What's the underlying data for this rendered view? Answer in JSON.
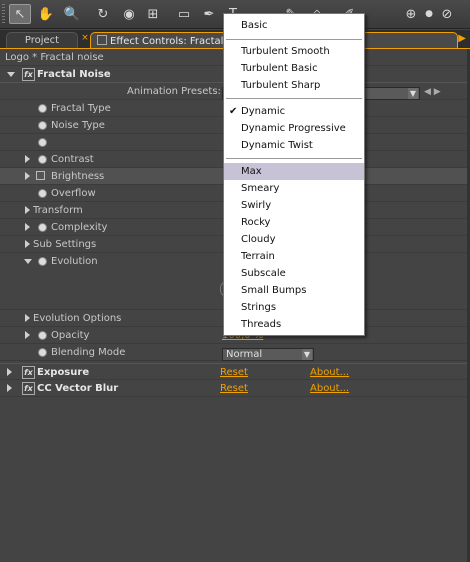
{
  "toolbar": {
    "tools": [
      {
        "name": "selection-tool-icon",
        "glyph": "↖",
        "active": true
      },
      {
        "name": "hand-tool-icon",
        "glyph": "✋"
      },
      {
        "name": "zoom-tool-icon",
        "glyph": "🔍"
      },
      {
        "name": "rotate-tool-icon",
        "glyph": "↻"
      },
      {
        "name": "orbit-camera-icon",
        "glyph": "◉"
      },
      {
        "name": "pan-behind-icon",
        "glyph": "⊞"
      },
      {
        "name": "rectangle-tool-icon",
        "glyph": "▭"
      },
      {
        "name": "pen-tool-icon",
        "glyph": "✒"
      },
      {
        "name": "type-tool-icon",
        "glyph": "T"
      },
      {
        "name": "brush-tool-icon",
        "glyph": "✎"
      },
      {
        "name": "eraser-tool-icon",
        "glyph": "◇"
      },
      {
        "name": "puppet-tool-icon",
        "glyph": "✐"
      },
      {
        "name": "axis-local-icon",
        "glyph": "⊕"
      },
      {
        "name": "axis-world-icon",
        "glyph": "●"
      },
      {
        "name": "axis-view-icon",
        "glyph": "⊘"
      }
    ]
  },
  "tabs": {
    "project": "Project",
    "effect_controls": "Effect Controls: Fractal"
  },
  "panel": {
    "layer_path": "Logo * Fractal noise",
    "fractal_noise": {
      "name": "Fractal Noise",
      "animation_presets_label": "Animation Presets:",
      "properties": {
        "fractal_type": "Fractal Type",
        "noise_type": "Noise Type",
        "invert": "",
        "contrast": "Contrast",
        "brightness": "Brightness",
        "overflow": "Overflow",
        "transform": "Transform",
        "complexity": "Complexity",
        "sub_settings": "Sub Settings",
        "evolution": "Evolution",
        "evolution_options": "Evolution Options",
        "opacity": "Opacity",
        "opacity_value": "100,0 %",
        "blending_mode": "Blending Mode",
        "blending_mode_value": "Normal"
      }
    },
    "exposure": {
      "name": "Exposure",
      "reset": "Reset",
      "about": "About..."
    },
    "cc_vector_blur": {
      "name": "CC Vector Blur",
      "reset": "Reset",
      "about": "About..."
    }
  },
  "dropdown": {
    "items": [
      {
        "label": "Basic"
      },
      {
        "label": "Turbulent Smooth"
      },
      {
        "label": "Turbulent Basic"
      },
      {
        "label": "Turbulent Sharp"
      },
      {
        "label": "Dynamic",
        "checked": true
      },
      {
        "label": "Dynamic Progressive"
      },
      {
        "label": "Dynamic Twist"
      },
      {
        "label": "Max",
        "highlighted": true
      },
      {
        "label": "Smeary"
      },
      {
        "label": "Swirly"
      },
      {
        "label": "Rocky"
      },
      {
        "label": "Cloudy"
      },
      {
        "label": "Terrain"
      },
      {
        "label": "Subscale"
      },
      {
        "label": "Small Bumps"
      },
      {
        "label": "Strings"
      },
      {
        "label": "Threads"
      }
    ],
    "checkmark": "✔"
  },
  "colors": {
    "accent": "#f0a000",
    "panel_bg": "#444444",
    "menu_highlight": "#c7c2d6"
  }
}
